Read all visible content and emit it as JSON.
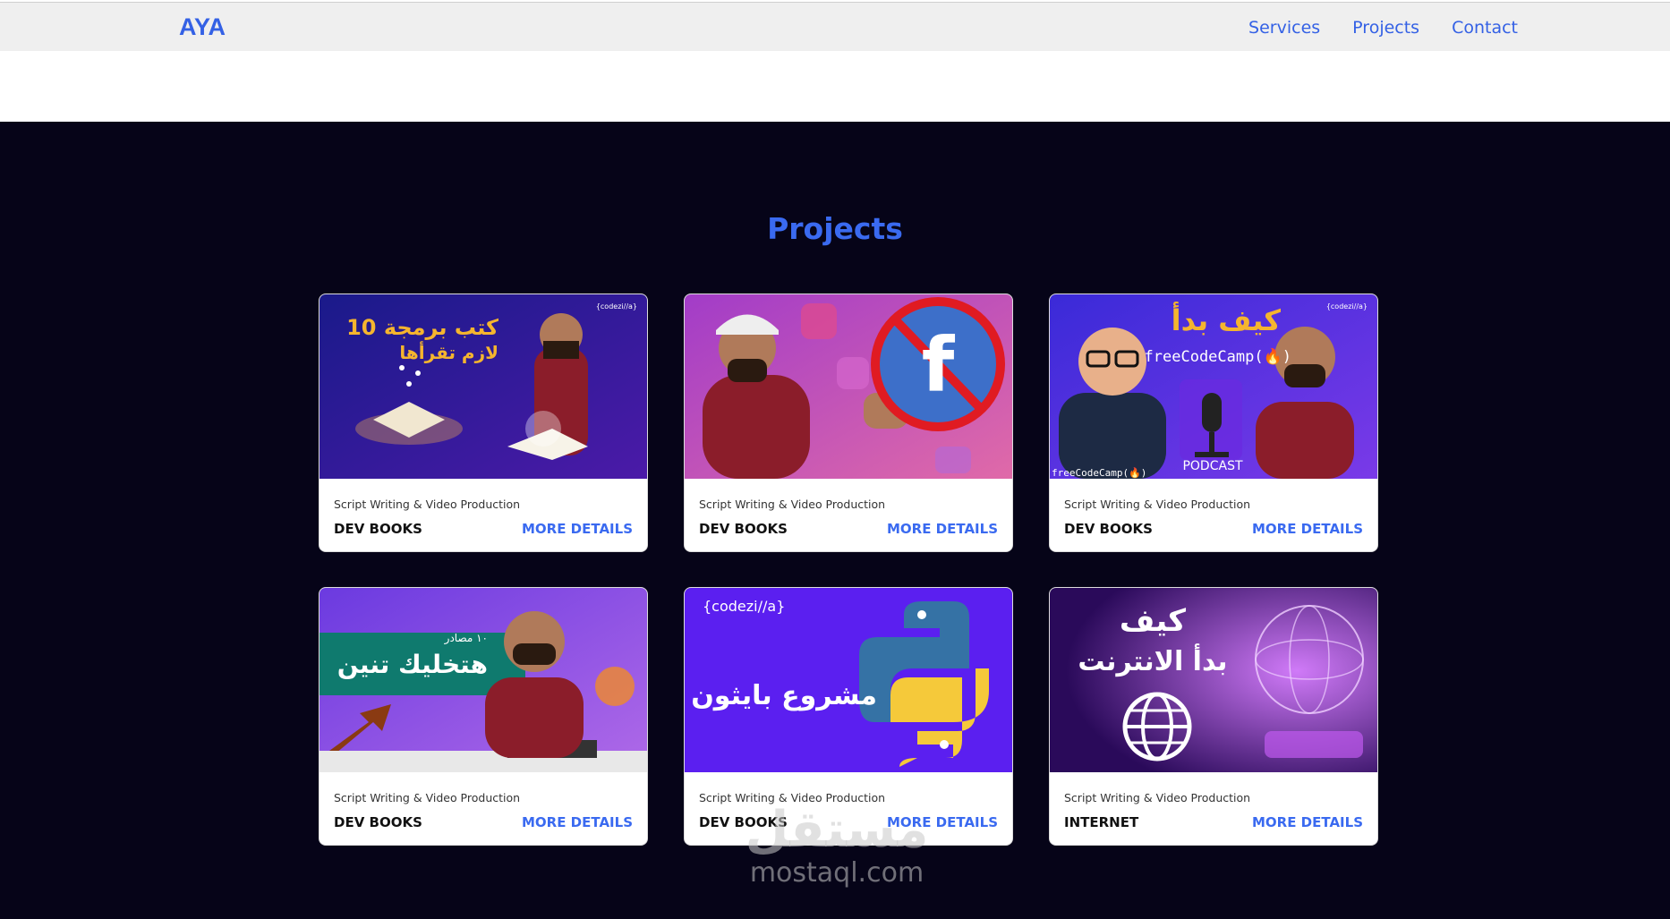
{
  "nav": {
    "brand": "AYA",
    "links": [
      "Services",
      "Projects",
      "Contact"
    ]
  },
  "projects": {
    "title": "Projects",
    "cards": [
      {
        "category": "Script Writing & Video Production",
        "title": "DEV BOOKS",
        "link": "MORE DETAILS",
        "thumb": {
          "headline": "10 كتب برمجة",
          "subline": "لازم تقرأها",
          "tag": "{codezi//a}"
        }
      },
      {
        "category": "Script Writing & Video Production",
        "title": "DEV BOOKS",
        "link": "MORE DETAILS",
        "thumb": {
          "headline": "f"
        }
      },
      {
        "category": "Script Writing & Video Production",
        "title": "DEV BOOKS",
        "link": "MORE DETAILS",
        "thumb": {
          "headline": "كيف بدأ",
          "subline": "freeCodeCamp(🔥)",
          "badge": "PODCAST",
          "tag": "{codezi//a}",
          "footer": "freeCodeCamp(🔥)"
        }
      },
      {
        "category": "Script Writing & Video Production",
        "title": "DEV BOOKS",
        "link": "MORE DETAILS",
        "thumb": {
          "headline": "هتخليك تنين",
          "subline": "١٠ مصادر"
        }
      },
      {
        "category": "Script Writing & Video Production",
        "title": "DEV BOOKS",
        "link": "MORE DETAILS",
        "thumb": {
          "headline": "مشروع بايثون",
          "tag": "{codezi//a}"
        }
      },
      {
        "category": "Script Writing & Video Production",
        "title": "INTERNET",
        "link": "MORE DETAILS",
        "thumb": {
          "headline": "كيف",
          "subline": "بدأ الانترنت"
        }
      }
    ]
  },
  "watermark": {
    "ar": "مستقل",
    "en": "mostaql.com"
  },
  "colors": {
    "accent": "#3a6af0",
    "section_bg": "#060418",
    "nav_bg": "#efefef"
  }
}
